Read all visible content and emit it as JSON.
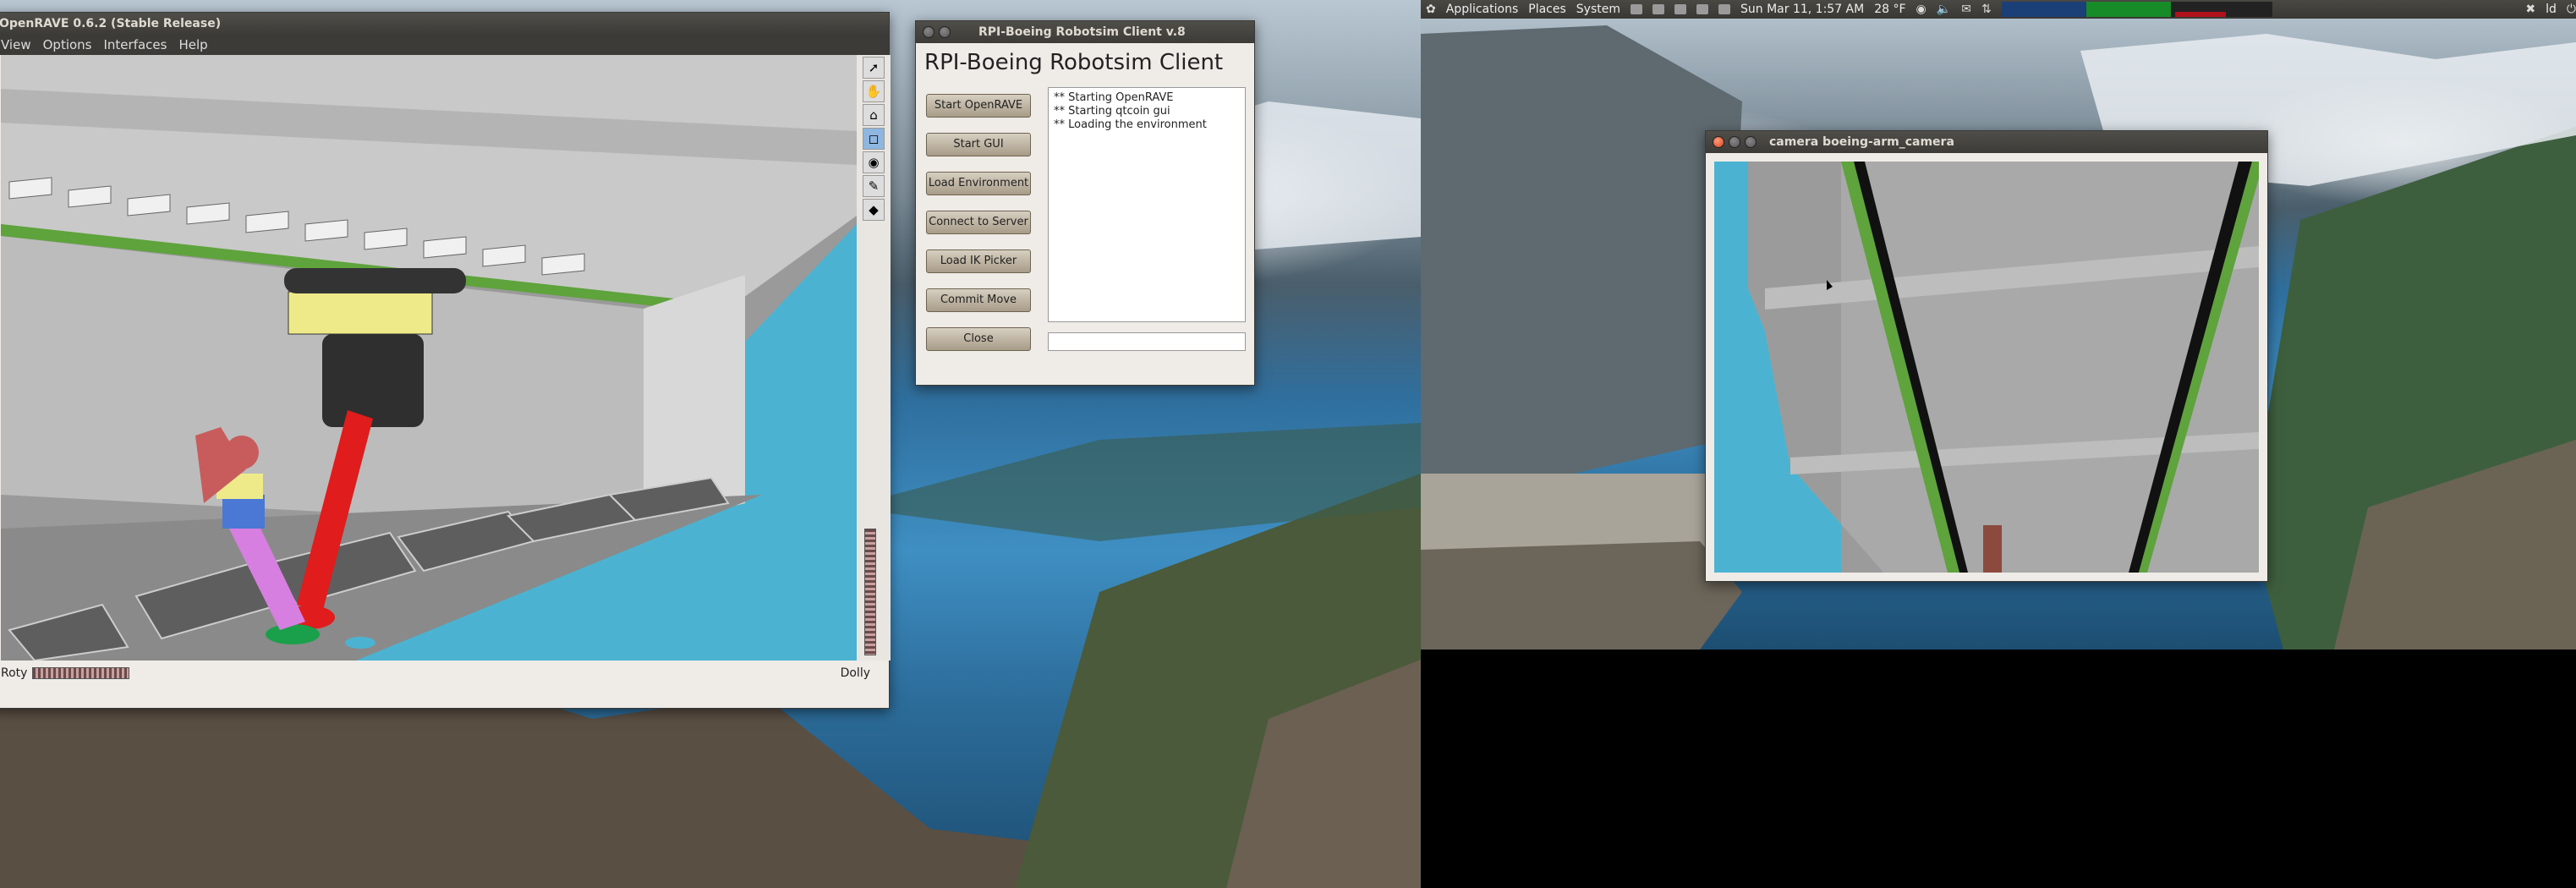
{
  "panel": {
    "menus": [
      "Applications",
      "Places",
      "System"
    ],
    "clock": "Sun Mar 11,  1:57 AM",
    "weather": "28 °F",
    "user": "ld"
  },
  "openrave": {
    "title": "OpenRAVE 0.6.2 (Stable Release)",
    "menu": [
      "View",
      "Options",
      "Interfaces",
      "Help"
    ],
    "status_left": "Roty",
    "status_right": "Dolly"
  },
  "client": {
    "title": "RPI-Boeing Robotsim Client v.8",
    "heading": "RPI-Boeing Robotsim Client",
    "buttons": [
      "Start OpenRAVE",
      "Start GUI",
      "Load Environment",
      "Connect to Server",
      "Load IK Picker",
      "Commit Move",
      "Close"
    ],
    "log": [
      "** Starting OpenRAVE",
      "** Starting qtcoin gui",
      "** Loading the environment"
    ],
    "command_value": ""
  },
  "camera": {
    "title": "camera boeing-arm_camera"
  },
  "colors": {
    "sky_blue": "#4bb3d1",
    "gray_surface": "#a9a9a9",
    "arm_red": "#e01c1c",
    "yellow_block": "#eeea8a",
    "green_strip": "#5ea33c"
  }
}
